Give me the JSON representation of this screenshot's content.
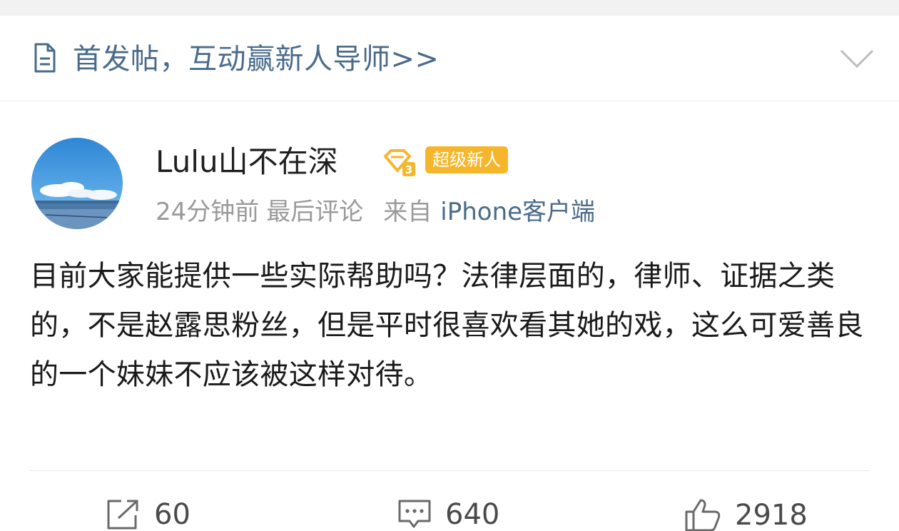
{
  "banner": {
    "icon": "document-icon",
    "text": "首发帖，互动赢新人导师>>",
    "chevron_icon": "chevron-down-icon"
  },
  "post": {
    "username": "Lulu山不在深",
    "vip_icon": "vip-level-3-icon",
    "badge": "超级新人",
    "meta": {
      "time": "24分钟前",
      "last": "最后评论",
      "from": "来自",
      "source": "iPhone客户端"
    },
    "content": "目前大家能提供一些实际帮助吗？法律层面的，律师、证据之类的，不是赵露思粉丝，但是平时很喜欢看其她的戏，这么可爱善良的一个妹妹不应该被这样对待。"
  },
  "actions": {
    "share": {
      "icon": "share-icon",
      "count": "60"
    },
    "comment": {
      "icon": "comment-icon",
      "count": "640"
    },
    "like": {
      "icon": "thumbs-up-icon",
      "count": "2918"
    }
  },
  "colors": {
    "link": "#4a6b8a",
    "badge": "#f5b62c",
    "meta": "#9a9a9a"
  }
}
